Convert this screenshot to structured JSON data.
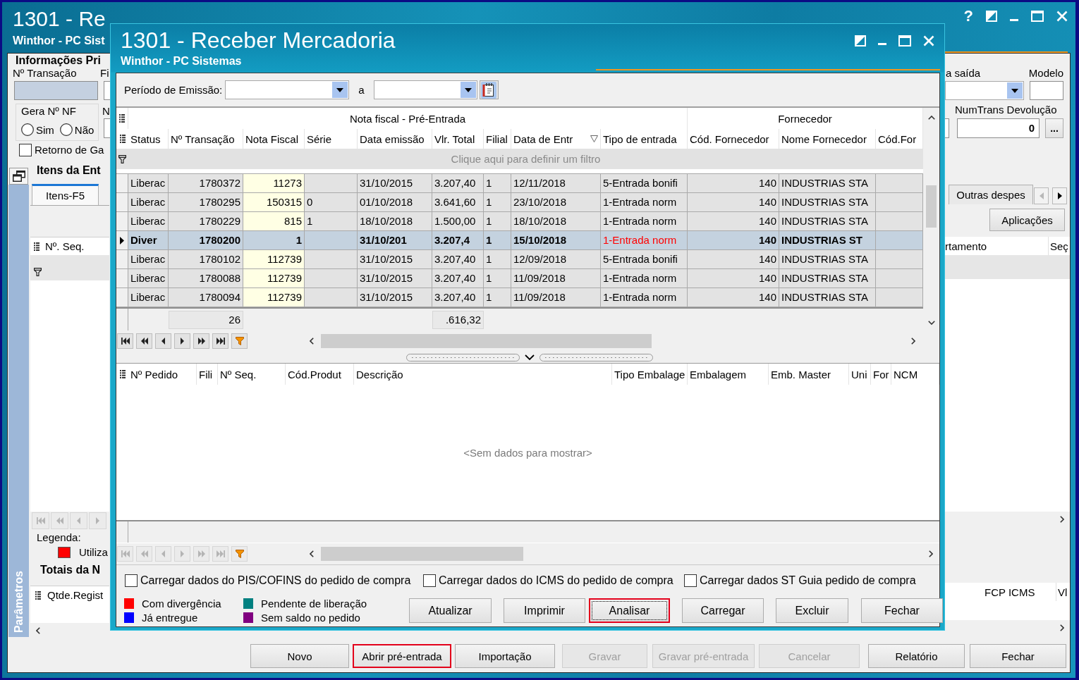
{
  "main_window": {
    "title": "1301 - Re",
    "subtitle": "Winthor - PC Sist",
    "help_button": "?",
    "info": {
      "heading": "Informações Pri",
      "transaction_field": {
        "label": "Nº Transação",
        "disabled": true
      },
      "field_2": {
        "label": "Fi",
        "disabled": false
      },
      "nf_group": {
        "label": "Gera Nº NF",
        "options": [
          {
            "label": "Sim",
            "selected": false
          },
          {
            "label": "Não",
            "selected": false
          }
        ]
      },
      "field_3": {
        "label": "N",
        "disabled": false
      },
      "return_checkbox": {
        "label": "Retorno de Ga",
        "checked": false
      },
      "exit_dropdown": {
        "label": "a saída"
      },
      "model_field": {
        "label": "Modelo"
      },
      "return_transaction": {
        "label": "NumTrans Devolução",
        "value": "0",
        "button": "..."
      }
    },
    "items": {
      "heading": "Itens da Ent",
      "tabs": [
        {
          "label": "Itens-F5",
          "selected": true
        },
        {
          "label": "Outras despes",
          "selected": false
        }
      ],
      "tab_arrows": [
        {
          "disabled": true
        },
        {
          "disabled": false
        }
      ],
      "apply_button": "Aplicações",
      "columns_left": [
        "Nº. Seq."
      ],
      "columns_right": [
        "rtamento",
        "Seç"
      ],
      "navigator_disabled": true
    },
    "legend": {
      "title": "Legenda:",
      "items": [
        {
          "label": "Utiliza",
          "color": "#ff0000"
        }
      ]
    },
    "totals": {
      "heading": "Totais da N",
      "columns_left": [
        "Qtde.Regist"
      ],
      "columns_right": [
        "FCP ICMS",
        "Vl"
      ]
    },
    "side_panel": {
      "label": "Parâmetros"
    },
    "buttons": [
      {
        "label": "Novo",
        "disabled": false,
        "highlighted": false
      },
      {
        "label": "Abrir pré-entrada",
        "disabled": false,
        "highlighted": true
      },
      {
        "label": "Importação",
        "disabled": false,
        "highlighted": false
      },
      {
        "label": "Gravar",
        "disabled": true,
        "highlighted": false
      },
      {
        "label": "Gravar pré-entrada",
        "disabled": true,
        "highlighted": false
      },
      {
        "label": "Cancelar",
        "disabled": true,
        "highlighted": false
      },
      {
        "label": "Relatório",
        "disabled": false,
        "highlighted": false
      },
      {
        "label": "Fechar",
        "disabled": false,
        "highlighted": false
      }
    ]
  },
  "dialog": {
    "title": "1301 - Receber Mercadoria",
    "subtitle": "Winthor - PC Sistemas",
    "period": {
      "label": "Período de Emissão:",
      "separator": "a"
    },
    "invoice_grid": {
      "bands": [
        {
          "label": "Nota fiscal - Pré-Entrada",
          "columns": [
            {
              "label": "Status",
              "filter_icon": false
            },
            {
              "label": "Nº Transação",
              "filter_icon": false
            },
            {
              "label": "Nota Fiscal",
              "filter_icon": false
            },
            {
              "label": "Série",
              "filter_icon": false
            },
            {
              "label": "Data emissão",
              "filter_icon": false
            },
            {
              "label": "Vlr. Total",
              "filter_icon": false
            },
            {
              "label": "Filial",
              "filter_icon": false
            },
            {
              "label": "Data de Entr",
              "filter_icon": true
            },
            {
              "label": "Tipo de entrada",
              "filter_icon": false
            }
          ]
        },
        {
          "label": "Fornecedor",
          "columns": [
            {
              "label": "Cód. Fornecedor",
              "filter_icon": false
            },
            {
              "label": "Nome Fornecedor",
              "filter_icon": false
            },
            {
              "label": "Cód.For",
              "filter_icon": false
            }
          ]
        }
      ],
      "filter_hint": "Clique aqui para definir um filtro",
      "rows": [
        {
          "selected": false,
          "color": "#000000",
          "status": "Liberac",
          "transaction": "1780372",
          "invoice": "11273",
          "issue_date": "31/10/2015",
          "total": "3.207,40",
          "branch": "1",
          "entry_date": "12/11/2018",
          "entry_type": "5-Entrada bonifi",
          "supplier_code": "140",
          "supplier_name": "INDUSTRIAS STA"
        },
        {
          "selected": false,
          "color": "#000000",
          "status": "Liberac",
          "transaction": "1780295",
          "invoice": "150315",
          "series": "0",
          "issue_date": "01/10/2018",
          "total": "3.641,60",
          "branch": "1",
          "entry_date": "23/10/2018",
          "entry_type": "1-Entrada norm",
          "supplier_code": "140",
          "supplier_name": "INDUSTRIAS STA"
        },
        {
          "selected": false,
          "color": "#000000",
          "status": "Liberac",
          "transaction": "1780229",
          "invoice": "815",
          "series": "1",
          "issue_date": "18/10/2018",
          "total": "1.500,00",
          "branch": "1",
          "entry_date": "18/10/2018",
          "entry_type": "1-Entrada norm",
          "supplier_code": "140",
          "supplier_name": "INDUSTRIAS STA"
        },
        {
          "selected": true,
          "color": "#ff0000",
          "status": "Diver",
          "transaction": "1780200",
          "invoice": "1",
          "issue_date": "31/10/201",
          "total": "3.207,4",
          "branch": "1",
          "entry_date": "15/10/2018",
          "entry_type": "1-Entrada norm",
          "supplier_code": "140",
          "supplier_name": "INDUSTRIAS ST"
        },
        {
          "selected": false,
          "color": "#000000",
          "status": "Liberac",
          "transaction": "1780102",
          "invoice": "112739",
          "issue_date": "31/10/2015",
          "total": "3.207,40",
          "branch": "1",
          "entry_date": "12/09/2018",
          "entry_type": "5-Entrada bonifi",
          "supplier_code": "140",
          "supplier_name": "INDUSTRIAS STA"
        },
        {
          "selected": false,
          "color": "#000000",
          "status": "Liberac",
          "transaction": "1780088",
          "invoice": "112739",
          "issue_date": "31/10/2015",
          "total": "3.207,40",
          "branch": "1",
          "entry_date": "11/09/2018",
          "entry_type": "1-Entrada norm",
          "supplier_code": "140",
          "supplier_name": "INDUSTRIAS STA"
        },
        {
          "selected": false,
          "color": "#000000",
          "status": "Liberac",
          "transaction": "1780094",
          "invoice": "112739",
          "issue_date": "31/10/2015",
          "total": "3.207,40",
          "branch": "1",
          "entry_date": "11/09/2018",
          "entry_type": "1-Entrada norm",
          "supplier_code": "140",
          "supplier_name": "INDUSTRIAS STA"
        }
      ],
      "footer": {
        "transaction": "26",
        "total": ".616,32"
      },
      "navigator_disabled": false
    },
    "order_grid": {
      "columns": [
        "Nº Pedido",
        "Fili",
        "Nº Seq.",
        "Cód.Produt",
        "Descrição",
        "Tipo Embalage",
        "Embalagem",
        "Emb. Master",
        "Uni",
        "For",
        "NCM"
      ],
      "empty_message": "<Sem dados para mostrar>",
      "navigator_disabled": true
    },
    "options": [
      {
        "label": "Carregar dados do PIS/COFINS do pedido de compra",
        "checked": false
      },
      {
        "label": "Carregar dados do ICMS do pedido de compra",
        "checked": false
      },
      {
        "label": "Carregar dados ST Guia pedido de compra",
        "checked": false
      }
    ],
    "legend": [
      {
        "label": "Com divergência",
        "color": "#ff0000"
      },
      {
        "label": "Pendente de liberação",
        "color": "#008080"
      },
      {
        "label": "Já entregue",
        "color": "#0000ff"
      },
      {
        "label": "Sem saldo no pedido",
        "color": "#800080"
      }
    ],
    "buttons": [
      {
        "label": "Atualizar",
        "highlighted": false,
        "focused": false
      },
      {
        "label": "Imprimir",
        "highlighted": false,
        "focused": false
      },
      {
        "label": "Analisar",
        "highlighted": true,
        "focused": true
      },
      {
        "label": "Carregar",
        "highlighted": false,
        "focused": false
      },
      {
        "label": "Excluir",
        "highlighted": false,
        "focused": false
      },
      {
        "label": "Fechar",
        "highlighted": false,
        "focused": false
      }
    ]
  }
}
